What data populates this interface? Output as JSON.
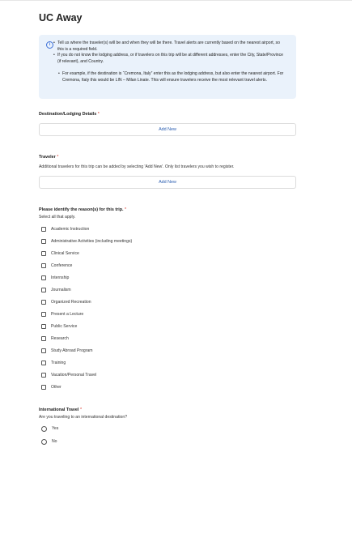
{
  "page": {
    "title": "UC Away"
  },
  "info": {
    "bullets": [
      "Tell us where the traveler(s) will be and when they will be there. Travel alerts are currently based on the nearest airport, so this is a required field.",
      "If you do not know the lodging address, or if travelers on this trip will be at different addresses, enter the City, State/Province (if relevant), and Country."
    ],
    "sub_bullet": "For example, if the destination is “Cremona, Italy” enter this as the lodging address, but also enter the nearest airport. For Cremona, Italy this would be LIN – Milan Linate. This will ensure travelers receive the most relevant travel alerts."
  },
  "destination": {
    "label": "Destination/Lodging Details",
    "required": "*",
    "add_label": "Add New"
  },
  "traveler": {
    "label": "Traveler",
    "required": "*",
    "description": "Additional travelers for this trip can be added by selecting 'Add New'. Only list travelers you wish to register.",
    "add_label": "Add New"
  },
  "reasons": {
    "label": "Please identify the reason(s) for this trip.",
    "required": "*",
    "hint": "Select all that apply.",
    "options": [
      "Academic Instruction",
      "Administrative Activities (including meetings)",
      "Clinical Service",
      "Conference",
      "Internship",
      "Journalism",
      "Organized Recreation",
      "Present a Lecture",
      "Public Service",
      "Research",
      "Study Abroad Program",
      "Training",
      "Vacation/Personal Travel",
      "Other"
    ]
  },
  "international": {
    "label": "International Travel",
    "required": "*",
    "question": "Are you traveling to an international destination?",
    "options": [
      "Yes",
      "No"
    ]
  }
}
